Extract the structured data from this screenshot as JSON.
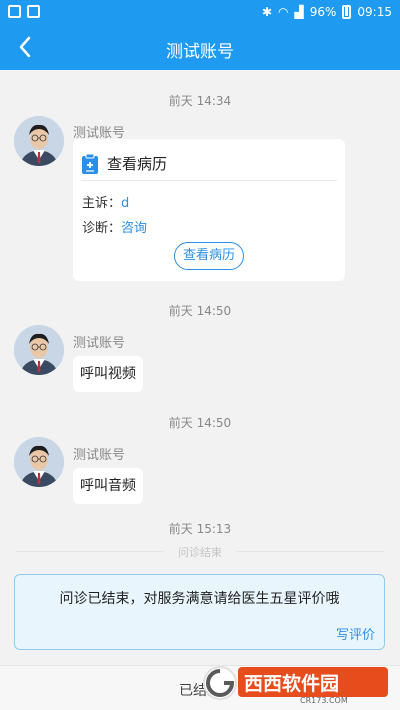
{
  "status_bar": {
    "battery": "96%",
    "time": "09:15"
  },
  "header": {
    "title": "测试账号"
  },
  "messages": [
    {
      "time": "前天 14:34",
      "sender": "测试账号",
      "card": {
        "title": "查看病历",
        "complaint_label": "主诉：",
        "complaint_value": "d",
        "diagnosis_label": "诊断：",
        "diagnosis_value": "咨询",
        "button": "查看病历"
      }
    },
    {
      "time": "前天 14:50",
      "sender": "测试账号",
      "text": "呼叫视频"
    },
    {
      "time": "前天 14:50",
      "sender": "测试账号",
      "text": "呼叫音频"
    }
  ],
  "last_time": "前天 15:13",
  "divider": "问诊结束",
  "rating": {
    "message": "问诊已结束，对服务满意请给医生五星评价哦",
    "link": "写评价"
  },
  "footer": {
    "status": "已结束"
  },
  "watermark": {
    "text": "西西软件园",
    "sub": "CR173.COM"
  },
  "colors": {
    "primary": "#1e9bf0",
    "link": "#2a8fe6"
  }
}
